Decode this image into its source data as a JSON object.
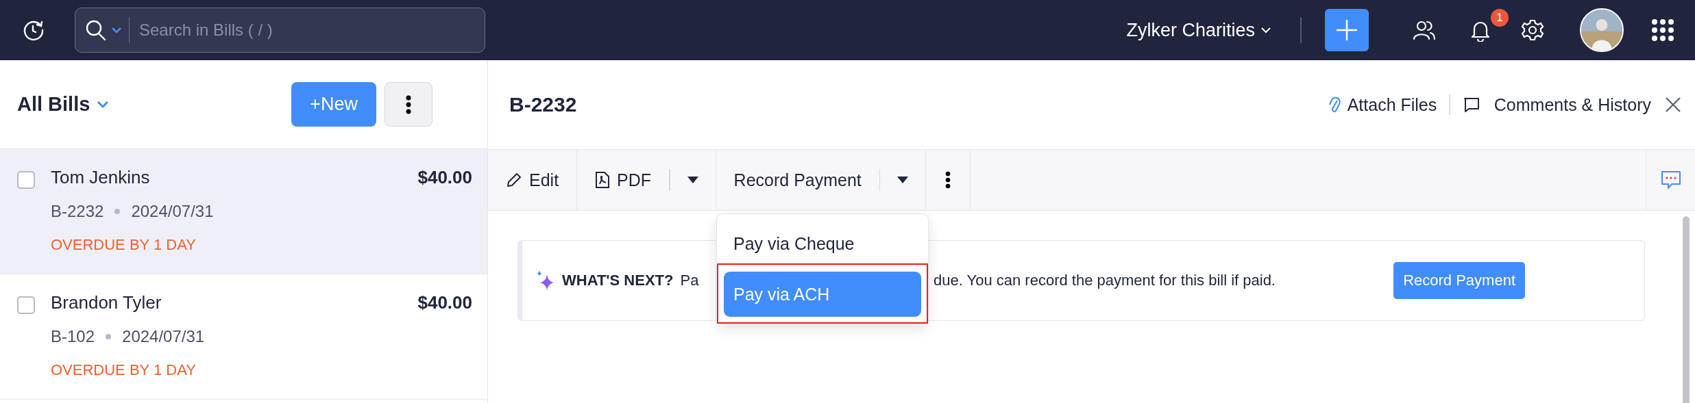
{
  "top_bar": {
    "search": {
      "placeholder": "Search in Bills ( / )"
    },
    "organization": "Zylker Charities",
    "notification_count": "1"
  },
  "sidebar": {
    "title": "All Bills",
    "new_button": "+New",
    "bills": [
      {
        "name": "Tom Jenkins",
        "amount": "$40.00",
        "number": "B-2232",
        "date": "2024/07/31",
        "status": "OVERDUE BY 1 DAY",
        "selected": true,
        "checked": false
      },
      {
        "name": "Brandon Tyler",
        "amount": "$40.00",
        "number": "B-102",
        "date": "2024/07/31",
        "status": "OVERDUE BY 1 DAY",
        "selected": false,
        "checked": false
      }
    ]
  },
  "detail": {
    "title": "B-2232",
    "attach": "Attach Files",
    "comments": "Comments & History",
    "toolbar": {
      "edit": "Edit",
      "pdf": "PDF",
      "record_payment": "Record Payment"
    },
    "menu": [
      {
        "label": "Pay via Cheque",
        "selected": false,
        "highlighted": false
      },
      {
        "label": "Pay via ACH",
        "selected": true,
        "highlighted": true
      }
    ],
    "banner": {
      "heading": "WHAT'S NEXT?",
      "text_before": "Pa",
      "text_after": "due. You can record the payment for this bill if paid.",
      "button": "Record Payment"
    }
  }
}
